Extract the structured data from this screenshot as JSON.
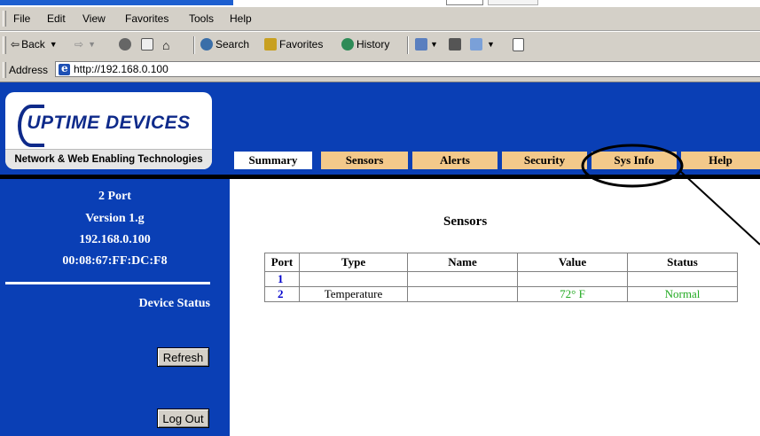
{
  "browser": {
    "menu": [
      "File",
      "Edit",
      "View",
      "Favorites",
      "Tools",
      "Help"
    ],
    "toolbar": {
      "back": "Back",
      "search": "Search",
      "favorites": "Favorites",
      "history": "History"
    },
    "address": {
      "label": "Address",
      "url": "http://192.168.0.100"
    }
  },
  "header": {
    "brand": "UPTIME DEVICES",
    "tagline": "Network & Web Enabling Technologies",
    "tabs": [
      "Summary",
      "Sensors",
      "Alerts",
      "Security",
      "Sys Info",
      "Help"
    ],
    "active_tab": "Summary"
  },
  "sidebar": {
    "model": "2 Port",
    "version": "Version 1.g",
    "ip": "192.168.0.100",
    "mac": "00:08:67:FF:DC:F8",
    "device_status": "Device Status",
    "refresh_label": "Refresh",
    "logout_label": "Log Out"
  },
  "main": {
    "title": "Sensors",
    "table": {
      "headers": [
        "Port",
        "Type",
        "Name",
        "Value",
        "Status"
      ],
      "rows": [
        {
          "port": "1",
          "type": "",
          "name": "",
          "value": "",
          "status": ""
        },
        {
          "port": "2",
          "type": "Temperature",
          "name": "",
          "value": "72° F",
          "status": "Normal"
        }
      ]
    }
  },
  "colors": {
    "header_blue": "#0a3fb5",
    "tab_inactive": "#f3c98a",
    "status_green": "#22aa22",
    "port_blue": "#0000cc"
  }
}
